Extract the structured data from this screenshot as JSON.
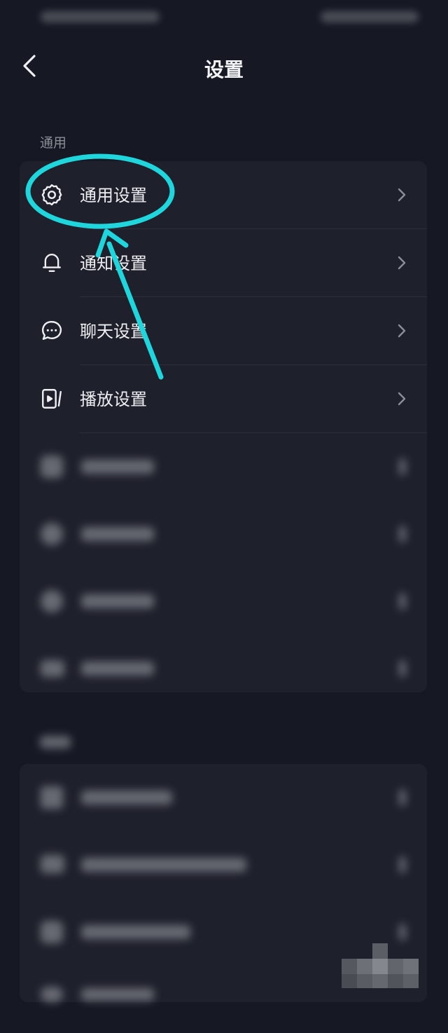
{
  "header": {
    "title": "设置"
  },
  "sections": [
    {
      "label": "通用",
      "items": [
        {
          "label": "通用设置",
          "icon": "gear-icon"
        },
        {
          "label": "通知设置",
          "icon": "bell-icon"
        },
        {
          "label": "聊天设置",
          "icon": "chat-bubble-icon"
        },
        {
          "label": "播放设置",
          "icon": "play-settings-icon"
        }
      ]
    }
  ],
  "colors": {
    "background": "#161823",
    "card": "#1e202b",
    "highlight": "#1fd6dc"
  }
}
